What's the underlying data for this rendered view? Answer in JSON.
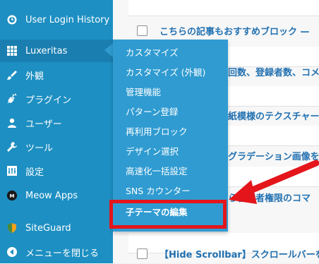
{
  "sidebar": {
    "items": [
      {
        "label": "User Login History",
        "icon": "user-login-history-icon"
      },
      {
        "label": "Luxeritas",
        "icon": "luxeritas-grid-icon"
      },
      {
        "label": "外観",
        "icon": "appearance-brush-icon"
      },
      {
        "label": "プラグイン",
        "icon": "plugin-icon"
      },
      {
        "label": "ユーザー",
        "icon": "user-icon"
      },
      {
        "label": "ツール",
        "icon": "wrench-icon"
      },
      {
        "label": "設定",
        "icon": "settings-icon"
      },
      {
        "label": "Meow Apps",
        "icon": "meow-apps-icon"
      },
      {
        "label": "SiteGuard",
        "icon": "siteguard-shield-icon"
      },
      {
        "label": "メニューを閉じる",
        "icon": "collapse-menu-icon"
      }
    ]
  },
  "flyout": {
    "items": [
      {
        "label": "カスタマイズ"
      },
      {
        "label": "カスタマイズ (外観)"
      },
      {
        "label": "管理機能"
      },
      {
        "label": "パターン登録"
      },
      {
        "label": "再利用ブロック"
      },
      {
        "label": "デザイン選択"
      },
      {
        "label": "高速化一括設定"
      },
      {
        "label": "SNS カウンター"
      },
      {
        "label": "子テーマの編集"
      }
    ]
  },
  "posts": {
    "rows": [
      {
        "title": "こちらの記事もおすすめブロック —"
      },
      {
        "title": "回数、登録者数、コメ"
      },
      {
        "title": "紙模様のテクスチャー"
      },
      {
        "title": "グラデーション画像を"
      },
      {
        "title": "ら管理者権限のコマ"
      },
      {
        "title": "【Hide Scrollbar】スクロールバーを"
      }
    ]
  },
  "colors": {
    "sidebar_bg": "#1d8fc2",
    "flyout_bg": "#2f9bd1",
    "highlight": "#e4151b",
    "link": "#2271b1"
  }
}
